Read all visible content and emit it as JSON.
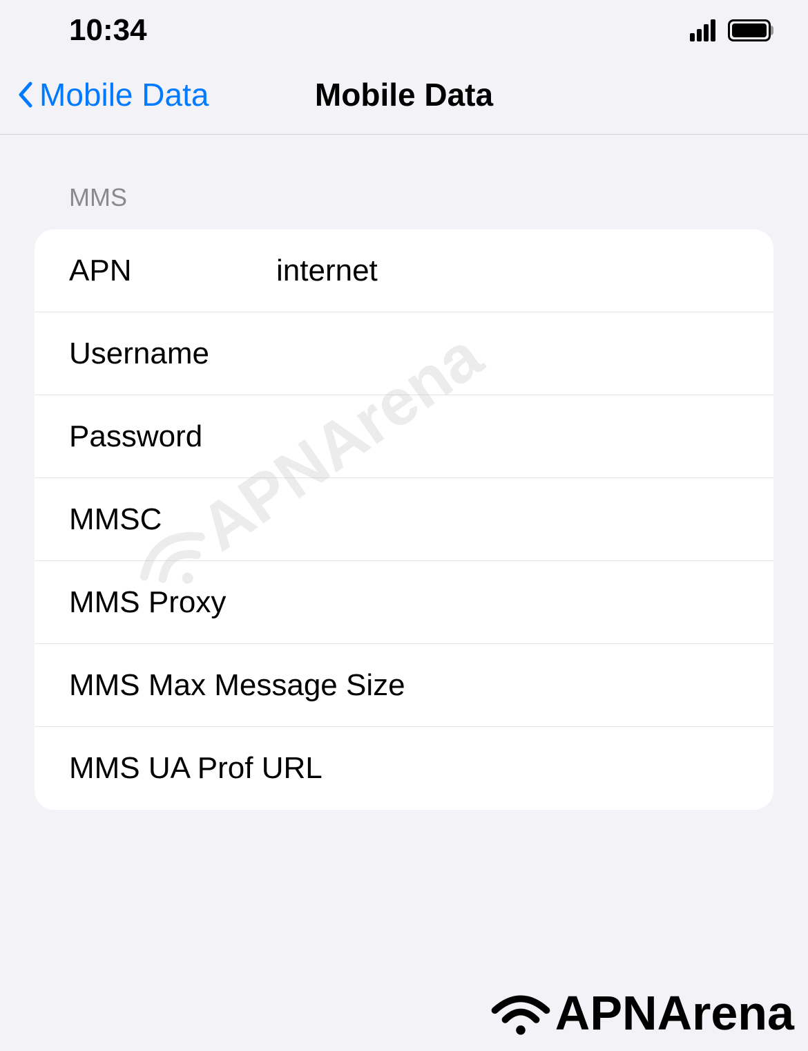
{
  "statusBar": {
    "time": "10:34"
  },
  "navBar": {
    "backLabel": "Mobile Data",
    "title": "Mobile Data"
  },
  "section": {
    "header": "MMS",
    "rows": [
      {
        "label": "APN",
        "value": "internet"
      },
      {
        "label": "Username",
        "value": ""
      },
      {
        "label": "Password",
        "value": ""
      },
      {
        "label": "MMSC",
        "value": ""
      },
      {
        "label": "MMS Proxy",
        "value": ""
      },
      {
        "label": "MMS Max Message Size",
        "value": ""
      },
      {
        "label": "MMS UA Prof URL",
        "value": ""
      }
    ]
  },
  "watermark": {
    "text": "APNArena"
  },
  "footerLogo": {
    "text": "APNArena"
  }
}
